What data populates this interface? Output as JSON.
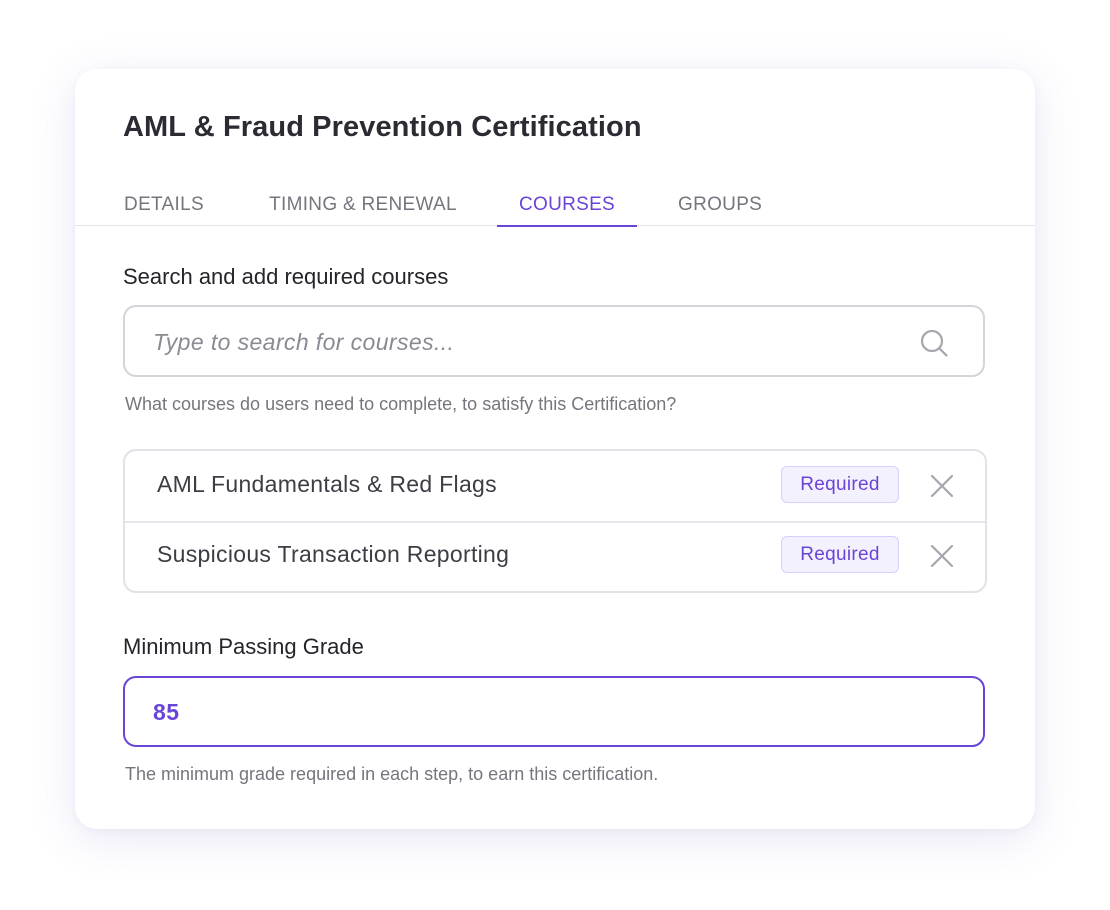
{
  "dialog": {
    "title": "AML & Fraud Prevention Certification"
  },
  "tabs": [
    {
      "label": "DETAILS",
      "active": false
    },
    {
      "label": "TIMING & RENEWAL",
      "active": false
    },
    {
      "label": "COURSES",
      "active": true
    },
    {
      "label": "GROUPS",
      "active": false
    }
  ],
  "course_search": {
    "label": "Search and add required courses",
    "placeholder": "Type to search for courses...",
    "value": "",
    "helper": "What courses do users need to complete, to satisfy this Certification?",
    "icon": "search-icon"
  },
  "courses": [
    {
      "name": "AML Fundamentals & Red Flags",
      "badge": "Required",
      "remove_icon": "close-icon"
    },
    {
      "name": "Suspicious Transaction Reporting",
      "badge": "Required",
      "remove_icon": "close-icon"
    }
  ],
  "passing_grade": {
    "label": "Minimum Passing Grade",
    "value": "85",
    "helper": "The minimum grade required in each step, to earn this certification."
  },
  "colors": {
    "accent": "#6a44d6",
    "badge_bg": "#f4f1fe",
    "text_primary": "#24242b",
    "text_muted": "#75757e",
    "border": "#d4d4db"
  }
}
